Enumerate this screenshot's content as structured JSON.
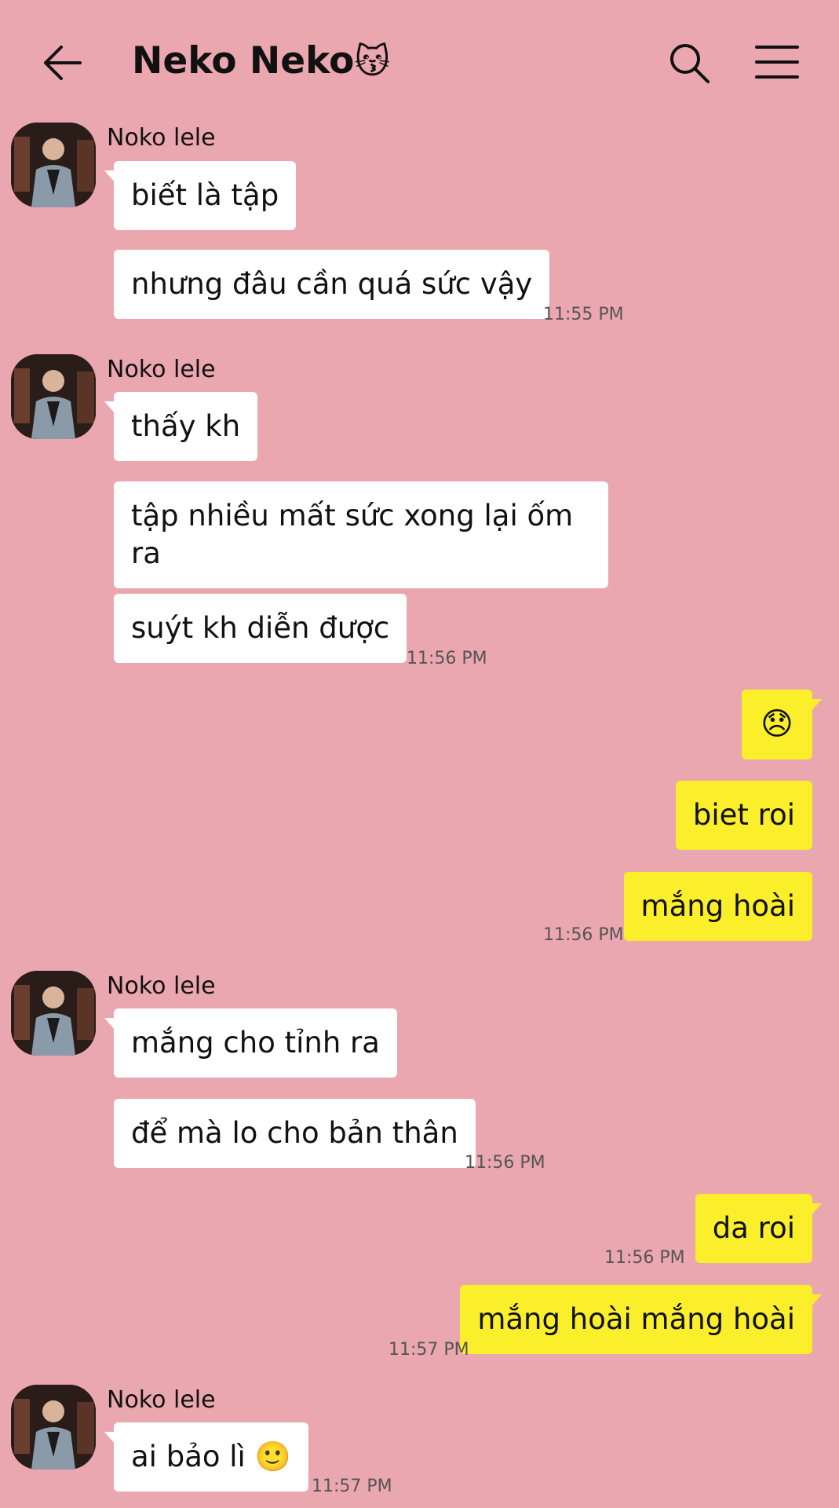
{
  "header": {
    "title": "Neko Neko",
    "title_emoji": "😽",
    "back_icon": "back-arrow-icon",
    "search_icon": "search-icon",
    "menu_icon": "menu-icon"
  },
  "colors": {
    "background": "#eba7af",
    "incoming_bubble": "#ffffff",
    "outgoing_bubble": "#fbee2a"
  },
  "groups": [
    {
      "sender": "Noko lele",
      "messages": [
        "biết là tập",
        "nhưng đâu cần quá sức vậy"
      ],
      "time": "11:55 PM"
    },
    {
      "sender": "Noko lele",
      "messages": [
        "thấy kh",
        "tập nhiều mất sức xong lại ốm ra",
        "suýt kh diễn được"
      ],
      "time": "11:56 PM"
    },
    {
      "sender": "me",
      "messages": [
        "😞",
        "biet roi",
        "mắng hoài"
      ],
      "time": "11:56 PM"
    },
    {
      "sender": "Noko lele",
      "messages": [
        "mắng cho tỉnh ra",
        "để mà lo cho bản thân"
      ],
      "time": "11:56 PM"
    },
    {
      "sender": "me",
      "messages": [
        "da roi"
      ],
      "time": "11:56 PM"
    },
    {
      "sender": "me",
      "messages": [
        "mắng hoài mắng hoài"
      ],
      "time": "11:57 PM"
    },
    {
      "sender": "Noko lele",
      "messages": [
        "ai bảo lì 🙂"
      ],
      "time": "11:57 PM"
    }
  ]
}
